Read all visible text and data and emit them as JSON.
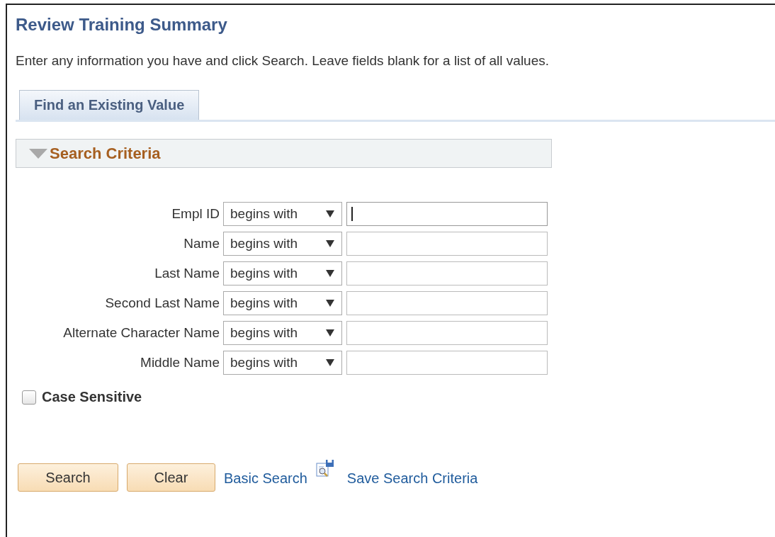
{
  "page": {
    "title": "Review Training Summary",
    "instructions": "Enter any information you have and click Search. Leave fields blank for a list of all values."
  },
  "tabs": [
    {
      "label": "Find an Existing Value",
      "selected": true
    }
  ],
  "section": {
    "title": "Search Criteria",
    "expanded": true
  },
  "fields": [
    {
      "label": "Empl ID",
      "operator": "begins with",
      "focused": true
    },
    {
      "label": "Name",
      "operator": "begins with",
      "focused": false
    },
    {
      "label": "Last Name",
      "operator": "begins with",
      "focused": false
    },
    {
      "label": "Second Last Name",
      "operator": "begins with",
      "focused": false
    },
    {
      "label": "Alternate Character Name",
      "operator": "begins with",
      "focused": false
    },
    {
      "label": "Middle Name",
      "operator": "begins with",
      "focused": false
    }
  ],
  "case_sensitive": {
    "label": "Case Sensitive",
    "checked": false
  },
  "buttons": [
    "Search",
    "Clear"
  ],
  "links": [
    {
      "label": "Basic Search"
    },
    {
      "label": "Save Search Criteria",
      "icon": true
    }
  ]
}
